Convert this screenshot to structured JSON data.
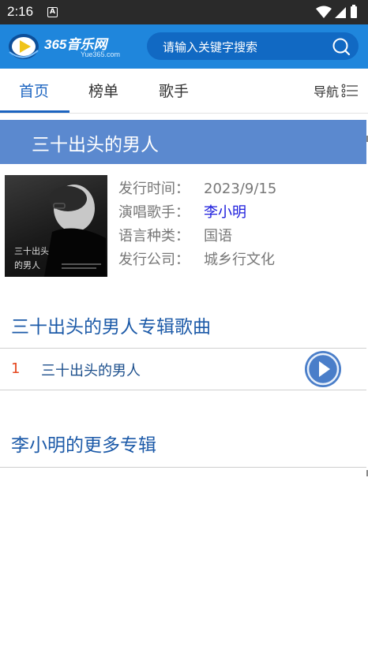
{
  "status_bar": {
    "time": "2:16",
    "notification": "A"
  },
  "header": {
    "logo_text": "365音乐网",
    "logo_sub": "Yue365.com",
    "search_placeholder": "请输入关键字搜索"
  },
  "nav": {
    "tabs": [
      {
        "label": "首页",
        "active": true
      },
      {
        "label": "榜单",
        "active": false
      },
      {
        "label": "歌手",
        "active": false
      }
    ],
    "guide_label": "导航"
  },
  "album": {
    "title": "三十出头的男人",
    "info": [
      {
        "label": "发行时间：",
        "value": "2023/9/15"
      },
      {
        "label": "演唱歌手：",
        "value": "李小明"
      },
      {
        "label": "语言种类：",
        "value": "国语"
      },
      {
        "label": "发行公司：",
        "value": "城乡行文化"
      }
    ]
  },
  "songs_section": {
    "title": "三十出头的男人专辑歌曲",
    "songs": [
      {
        "number": "1",
        "name": "三十出头的男人"
      }
    ]
  },
  "more_section": {
    "title": "李小明的更多专辑"
  },
  "colors": {
    "header_bg": "#1f86dc",
    "accent": "#1c64c0",
    "title_bar": "#5b89cf",
    "song_number": "#e5461d",
    "singer_link": "#1a1adc"
  }
}
